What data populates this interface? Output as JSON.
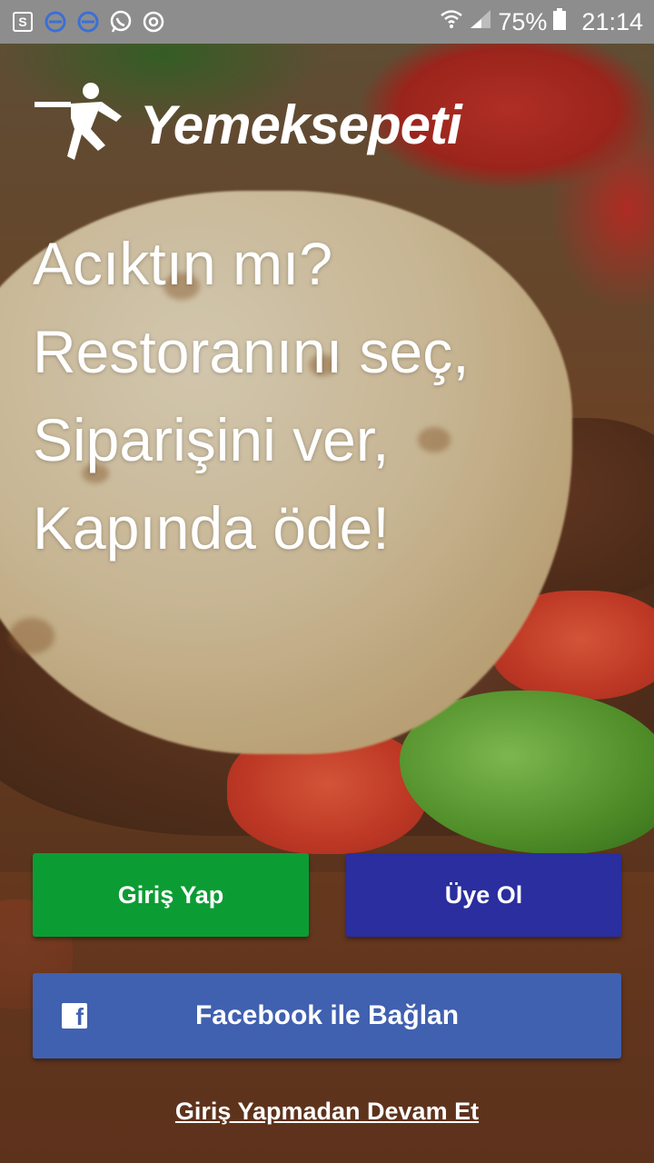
{
  "status_bar": {
    "left_icons": [
      "sim-s-icon",
      "sync-icon",
      "sync-icon",
      "whatsapp-icon",
      "chrome-icon"
    ],
    "battery": "75%",
    "time": "21:14"
  },
  "logo": {
    "text": "Yemeksepeti"
  },
  "tagline": {
    "line1": "Acıktın mı?",
    "line2": "Restoranını seç,",
    "line3": "Siparişini ver,",
    "line4": "Kapında öde!"
  },
  "buttons": {
    "login": "Giriş Yap",
    "register": "Üye Ol",
    "facebook": "Facebook ile Bağlan",
    "facebook_icon": "f",
    "skip": "Giriş Yapmadan Devam Et"
  },
  "colors": {
    "login": "#0c9c34",
    "register": "#2a2e9e",
    "facebook": "#4060b0",
    "status_bar": "#8d8d8d"
  }
}
